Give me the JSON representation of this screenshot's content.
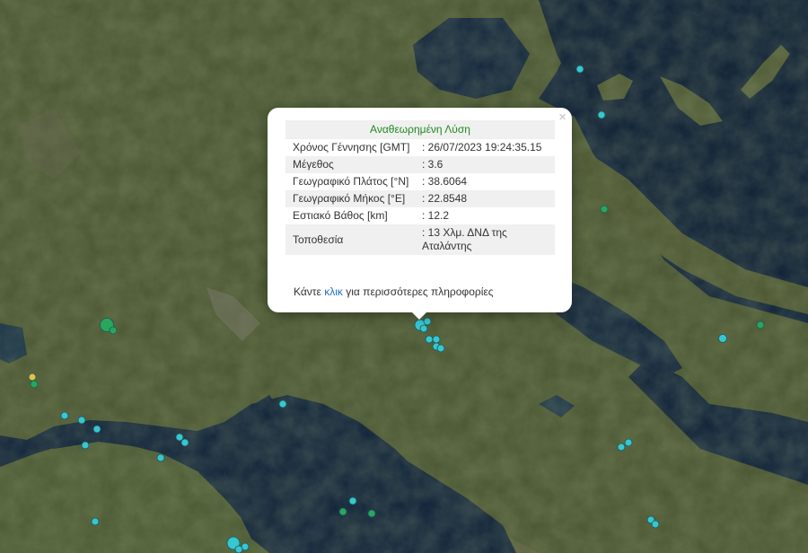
{
  "popup": {
    "header": "Αναθεωρημένη Λύση",
    "close_symbol": "×",
    "rows": [
      {
        "label": "Χρόνος Γέννησης [GMT]",
        "value": ": 26/07/2023 19:24:35.15"
      },
      {
        "label": "Μέγεθος",
        "value": ": 3.6"
      },
      {
        "label": "Γεωγραφικό Πλάτος [°N]",
        "value": ": 38.6064"
      },
      {
        "label": "Γεωγραφικό Μήκος [°E]",
        "value": ": 22.8548"
      },
      {
        "label": "Εστιακό Βάθος [km]",
        "value": ": 12.2"
      },
      {
        "label": "Τοποθεσία",
        "value": ": 13 Χλμ. ΔΝΔ της Αταλάντης"
      }
    ],
    "footer_pre": "Κάντε ",
    "footer_link": "κλικ",
    "footer_post": " για περισσότερες πληροφορίες"
  },
  "map": {
    "marker_colors": {
      "cyan": "#38c6cf",
      "green": "#2aa65a",
      "yellow": "#e4c23a"
    },
    "land_color": "#3d4a2a",
    "sea_color": "#0f2238"
  }
}
